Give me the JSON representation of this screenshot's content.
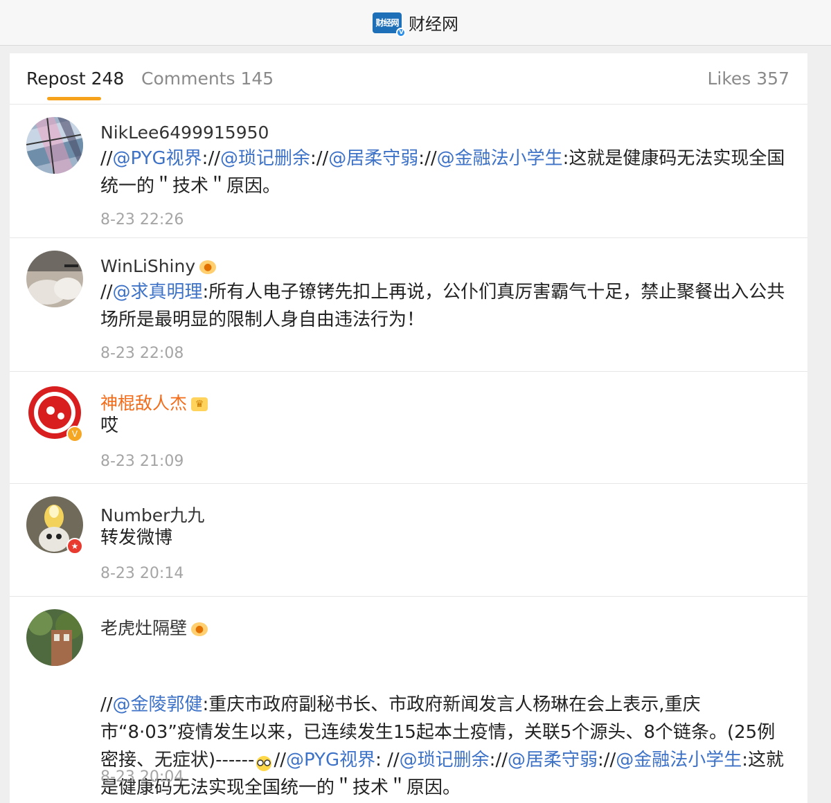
{
  "header": {
    "brand_name": "财经网",
    "logo_text": "财经网",
    "badge_icon": "verified-v-icon"
  },
  "tabs": {
    "repost_label": "Repost",
    "repost_count": "248",
    "comments_label": "Comments",
    "comments_count": "145",
    "likes_label": "Likes",
    "likes_count": "357",
    "accent_color": "#f7a21b"
  },
  "posts": [
    {
      "username": "NikLee6499915950",
      "segments": [
        "//",
        "@PYG视界",
        ":",
        "//",
        "@琐记删余",
        ":",
        "//",
        "@居柔守弱",
        ":",
        "//",
        "@金融法小学生",
        ":这就是健康码无法实现全国统一的＂技术＂原因。"
      ],
      "time": "8-23 22:26"
    },
    {
      "username": "WinLiShiny",
      "segments": [
        "//",
        "@求真明理",
        ":所有人电子镣铐先扣上再说，公仆们真厉害霸气十足，禁止聚餐出入公共场所是最明显的限制人身自由违法行为！"
      ],
      "time": "8-23 22:08"
    },
    {
      "username": "神棍敌人杰",
      "segments": [
        "哎"
      ],
      "time": "8-23 21:09"
    },
    {
      "username": "Number九九",
      "segments": [
        "转发微博"
      ],
      "time": "8-23 20:14"
    },
    {
      "username": "老虎灶隔壁",
      "segments": [
        "//",
        "@金陵郭健",
        ":重庆市政府副秘书长、市政府新闻发言人杨琳在会上表示,重庆市“8·03”疫情发生以来，已连续发生15起本土疫情，关联5个源头、8个链条。(25例密接、无症状)------",
        "//",
        "@PYG视界",
        ": //",
        "@琐记删余",
        ":",
        "//",
        "@居柔守弱",
        ":",
        "//",
        "@金融法小学生",
        ":这就是健康码无法实现全国统一的＂技术＂原因。"
      ],
      "time": "8-23 20:04"
    }
  ],
  "colors": {
    "mention": "#3d72c7",
    "vip_name": "#f26c1a",
    "time": "#a5a5a5"
  }
}
